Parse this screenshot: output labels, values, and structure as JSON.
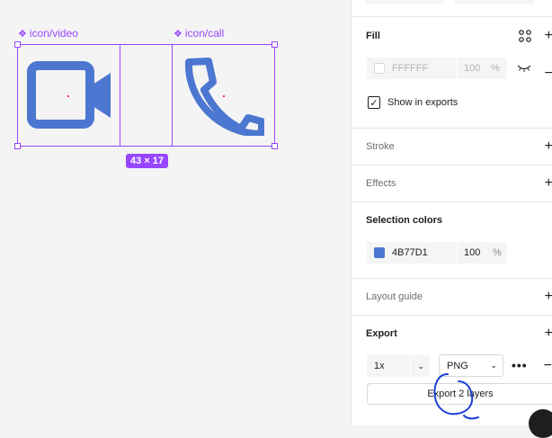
{
  "canvas": {
    "components": [
      {
        "label": "icon/video",
        "color": "#4b77d1"
      },
      {
        "label": "icon/call",
        "color": "#4b77d1"
      }
    ],
    "selection_size": "43 × 17",
    "selection_color": "#9747ff"
  },
  "panel": {
    "fill": {
      "title": "Fill",
      "hex": "FFFFFF",
      "opacity": "100",
      "percent": "%",
      "show_in_exports": "Show in exports"
    },
    "stroke": {
      "title": "Stroke"
    },
    "effects": {
      "title": "Effects"
    },
    "selection_colors": {
      "title": "Selection colors",
      "hex": "4B77D1",
      "opacity": "100",
      "percent": "%",
      "swatch": "#4b77d1"
    },
    "layout_guide": {
      "title": "Layout guide"
    },
    "export": {
      "title": "Export",
      "scale": "1x",
      "format": "PNG",
      "button": "Export 2 layers"
    }
  }
}
